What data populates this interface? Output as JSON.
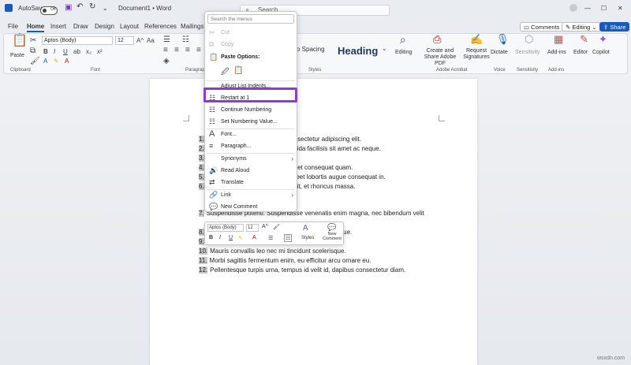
{
  "titlebar": {
    "autosave": "AutoSave",
    "toggle_state": "Off",
    "doc_title": "Document1 • Word",
    "search_placeholder": "Search"
  },
  "menu_tabs": [
    "File",
    "Home",
    "Insert",
    "Draw",
    "Design",
    "Layout",
    "References",
    "Mailings"
  ],
  "right_buttons": {
    "comments": "Comments",
    "editing": "Editing",
    "share": "Share"
  },
  "ribbon": {
    "paste": "Paste",
    "font_name": "Aptos (Body)",
    "font_size": "12",
    "groups": {
      "clipboard": "Clipboard",
      "font": "Font",
      "paragraph": "Paragraph",
      "styles": "Styles",
      "adobe": "Adobe Acrobat",
      "voice": "Voice",
      "sensitivity": "Sensitivity",
      "addins": "Add-ins"
    },
    "style_no_spacing": "o Spacing",
    "style_heading": "Heading",
    "editing": "Editing",
    "create_share": "Create and Share Adobe PDF",
    "request_sig": "Request Signatures",
    "dictate": "Dictate",
    "sensitivity": "Sensitivity",
    "addins": "Add-ins",
    "editor": "Editor",
    "copilot": "Copilot"
  },
  "context_menu": {
    "search": "Search the menus",
    "cut": "Cut",
    "copy": "Copy",
    "paste_options": "Paste Options:",
    "adjust": "Adjust List Indents...",
    "restart": "Restart at 1",
    "continue": "Continue Numbering",
    "set_value": "Set Numbering Value...",
    "font": "Font...",
    "paragraph": "Paragraph...",
    "synonyms": "Synonyms",
    "read_aloud": "Read Aloud",
    "translate": "Translate",
    "link": "Link",
    "new_comment": "New Comment"
  },
  "mini_toolbar": {
    "font": "Aptos (Body)",
    "size": "12",
    "styles": "Styles",
    "new_comment": "New Comment"
  },
  "doc_lines": [
    {
      "n": "1.",
      "t": "nsectetur adipiscing elit."
    },
    {
      "n": "2.",
      "t": "vida facilisis sit amet ac neque."
    },
    {
      "n": "3.",
      "t": ""
    },
    {
      "n": "4.",
      "t": "eet consequat quam."
    },
    {
      "n": "5.",
      "t": "reet lobortis augue consequat in."
    },
    {
      "n": "6.",
      "t": "sit, et rhoncus massa."
    },
    {
      "n": "7.",
      "t": "Suspendisse potenti. Suspendisse venenatis enim magna, nec bibendum velit"
    },
    {
      "n": "8.",
      "t": "que."
    },
    {
      "n": "9.",
      "t": ""
    },
    {
      "n": "10.",
      "t": "Mauris convallis leo nec mi tincidunt scelerisque."
    },
    {
      "n": "11.",
      "t": "Morbi sagittis fermentum enim, eu efficitur arcu ornare eu."
    },
    {
      "n": "12.",
      "t": "Pellentesque turpis urna, tempus id velit id, dapibus consectetur diam."
    }
  ],
  "watermark": "wsxdn.com",
  "colors": {
    "accent": "#185abd",
    "highlight_box": "#8e3bd6"
  }
}
